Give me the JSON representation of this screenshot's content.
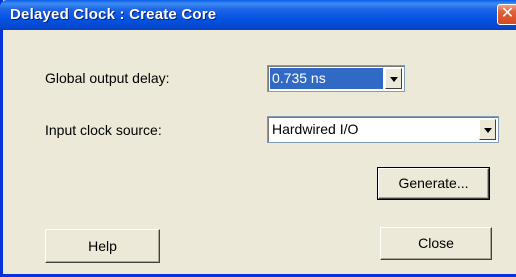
{
  "window": {
    "title": "Delayed Clock : Create Core",
    "close_glyph": "✕"
  },
  "form": {
    "global_output_delay": {
      "label": "Global output delay:",
      "value": "0.735 ns"
    },
    "input_clock_source": {
      "label": "Input clock source:",
      "value": "Hardwired I/O"
    }
  },
  "buttons": {
    "generate": "Generate...",
    "help": "Help",
    "close": "Close"
  },
  "icons": {
    "close": "close-icon",
    "dropdown": "chevron-down-icon"
  },
  "colors": {
    "titlebar": "#0554e3",
    "selection": "#316ac5",
    "face": "#ece9d8",
    "close_button": "#d34a22"
  }
}
